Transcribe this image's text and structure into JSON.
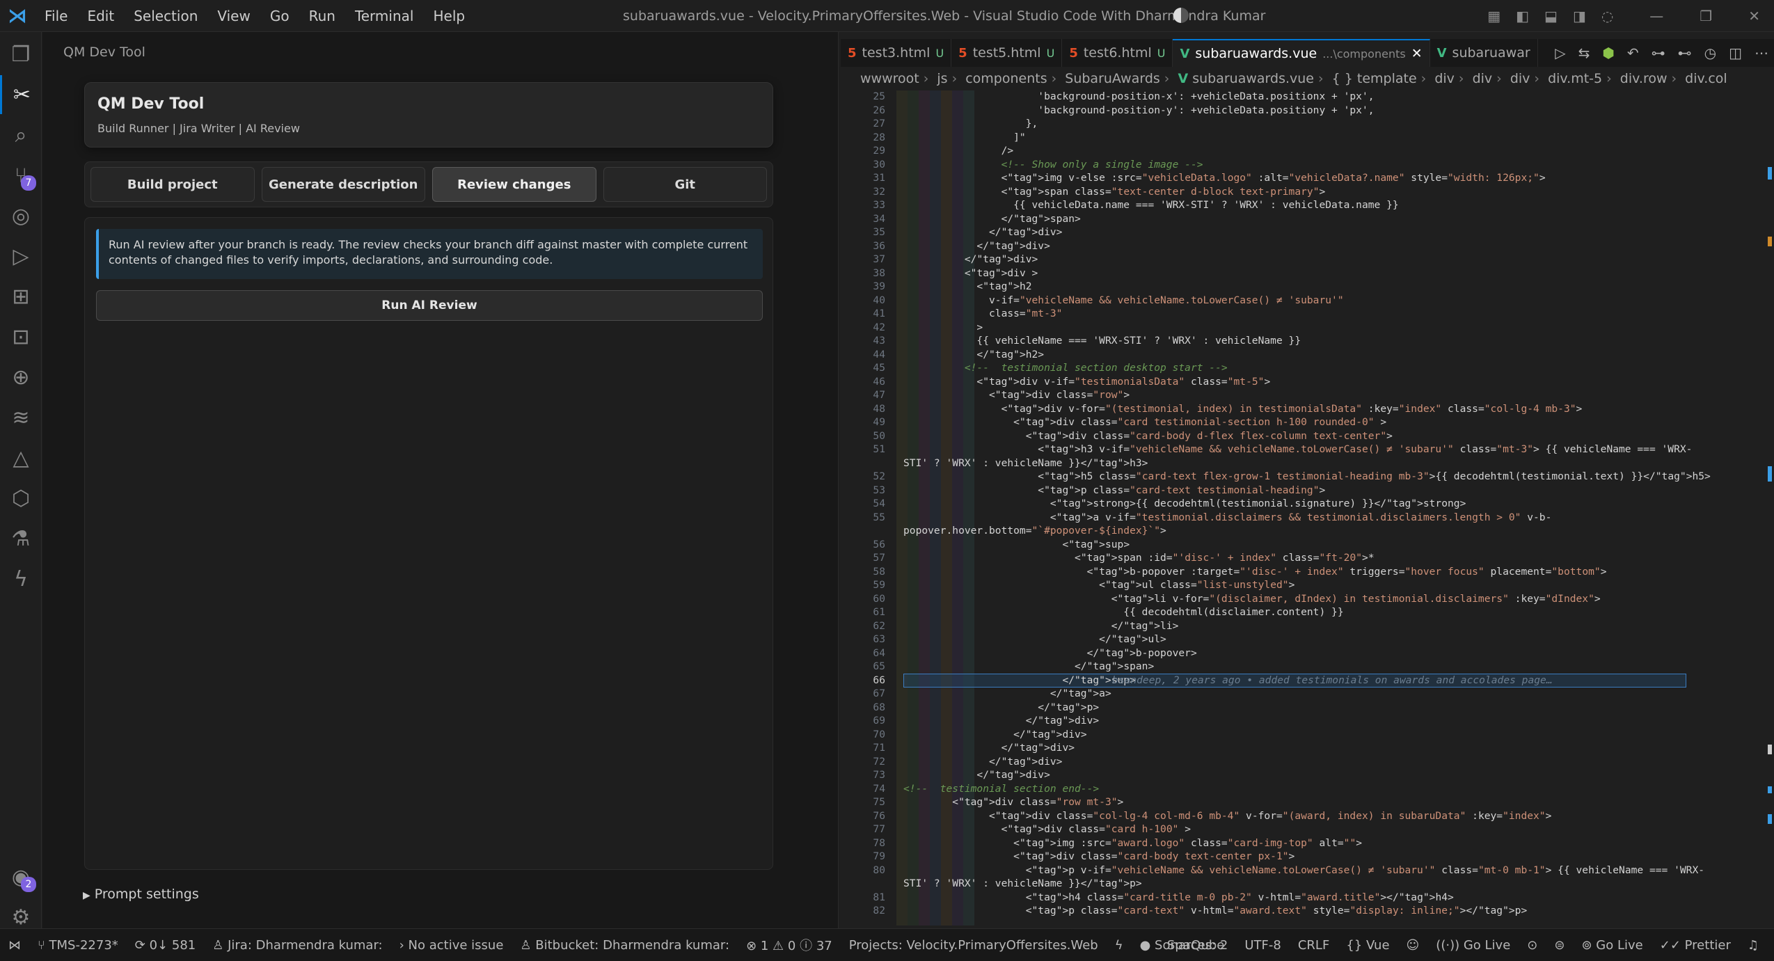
{
  "titlebar": {
    "menu": [
      "File",
      "Edit",
      "Selection",
      "View",
      "Go",
      "Run",
      "Terminal",
      "Help"
    ],
    "window_title": "subaruawards.vue - Velocity.PrimaryOffersites.Web - Visual Studio Code With Dharmendra Kumar"
  },
  "activity": {
    "scm_badge": "7",
    "accounts_badge": "2"
  },
  "sidepanel": {
    "title": "QM Dev Tool",
    "header_title": "QM Dev Tool",
    "header_subtitle": "Build Runner | Jira Writer | AI Review",
    "buttons": [
      "Build project",
      "Generate description",
      "Review changes",
      "Git"
    ],
    "active_button": "Review changes",
    "info_text": "Run AI review after your branch is ready. The review checks your branch diff against master with complete current contents of changed files to verify imports, declarations, and surrounding code.",
    "run_button": "Run AI Review",
    "prompt_settings": "Prompt settings"
  },
  "editor": {
    "tabs": [
      {
        "name": "test3.html",
        "status": "U",
        "type": "html"
      },
      {
        "name": "test5.html",
        "status": "U",
        "type": "html"
      },
      {
        "name": "test6.html",
        "status": "U",
        "type": "html"
      },
      {
        "name": "subaruawards.vue",
        "path": "...\\components",
        "type": "vue",
        "active": true
      },
      {
        "name": "subaruawar",
        "type": "vue"
      }
    ],
    "breadcrumb": [
      "wwwroot",
      "js",
      "components",
      "SubaruAwards",
      "subaruawards.vue",
      "{ } template",
      "div",
      "div",
      "div",
      "div.mt-5",
      "div.row",
      "div.col"
    ],
    "current_line": 66,
    "blame_text": "bsandeep, 2 years ago • added testimonials on awards and accolades page…",
    "lines": [
      {
        "n": "25",
        "t": "                      'background-position-x': +vehicleData.positionx + 'px',"
      },
      {
        "n": "26",
        "t": "                      'background-position-y': +vehicleData.positiony + 'px',"
      },
      {
        "n": "27",
        "t": "                    },"
      },
      {
        "n": "28",
        "t": "                  ]\""
      },
      {
        "n": "29",
        "t": "                />"
      },
      {
        "n": "30",
        "t": "                <!-- Show only a single image -->"
      },
      {
        "n": "31",
        "t": "                <img v-else :src=\"vehicleData.logo\" :alt=\"vehicleData?.name\" style=\"width: 126px;\">"
      },
      {
        "n": "32",
        "t": "                <span class=\"text-center d-block text-primary\">"
      },
      {
        "n": "33",
        "t": "                  {{ vehicleData.name === 'WRX-STI' ? 'WRX' : vehicleData.name }}"
      },
      {
        "n": "34",
        "t": "                </span>"
      },
      {
        "n": "35",
        "t": "              </div>"
      },
      {
        "n": "36",
        "t": "            </div>"
      },
      {
        "n": "37",
        "t": "          </div>"
      },
      {
        "n": "38",
        "t": "          <div >"
      },
      {
        "n": "39",
        "t": "            <h2"
      },
      {
        "n": "40",
        "t": "              v-if=\"vehicleName && vehicleName.toLowerCase() ≠ 'subaru'\""
      },
      {
        "n": "41",
        "t": "              class=\"mt-3\""
      },
      {
        "n": "42",
        "t": "            >"
      },
      {
        "n": "43",
        "t": "            {{ vehicleName === 'WRX-STI' ? 'WRX' : vehicleName }}"
      },
      {
        "n": "44",
        "t": "            </h2>"
      },
      {
        "n": "45",
        "t": "          <!--  testimonial section desktop start -->"
      },
      {
        "n": "46",
        "t": "            <div v-if=\"testimonialsData\" class=\"mt-5\">"
      },
      {
        "n": "47",
        "t": "              <div class=\"row\">"
      },
      {
        "n": "48",
        "t": "                <div v-for=\"(testimonial, index) in testimonialsData\" :key=\"index\" class=\"col-lg-4 mb-3\">"
      },
      {
        "n": "49",
        "t": "                  <div class=\"card testimonial-section h-100 rounded-0\" >"
      },
      {
        "n": "50",
        "t": "                    <div class=\"card-body d-flex flex-column text-center\">"
      },
      {
        "n": "51",
        "t": "                      <h3 v-if=\"vehicleName && vehicleName.toLowerCase() ≠ 'subaru'\" class=\"mt-3\"> {{ vehicleName === 'WRX-"
      },
      {
        "n": "",
        "t": "STI' ? 'WRX' : vehicleName }}</h3>"
      },
      {
        "n": "52",
        "t": "                      <h5 class=\"card-text flex-grow-1 testimonial-heading mb-3\">{{ decodehtml(testimonial.text) }}</h5>"
      },
      {
        "n": "53",
        "t": "                      <p class=\"card-text testimonial-heading\">"
      },
      {
        "n": "54",
        "t": "                        <strong>{{ decodehtml(testimonial.signature) }}</strong>"
      },
      {
        "n": "55",
        "t": "                        <a v-if=\"testimonial.disclaimers && testimonial.disclaimers.length > 0\" v-b-"
      },
      {
        "n": "",
        "t": "popover.hover.bottom=\"`#popover-${index}`\">"
      },
      {
        "n": "56",
        "t": "                          <sup>"
      },
      {
        "n": "57",
        "t": "                            <span :id=\"'disc-' + index\" class=\"ft-20\">*"
      },
      {
        "n": "58",
        "t": "                              <b-popover :target=\"'disc-' + index\" triggers=\"hover focus\" placement=\"bottom\">"
      },
      {
        "n": "59",
        "t": "                                <ul class=\"list-unstyled\">"
      },
      {
        "n": "60",
        "t": "                                  <li v-for=\"(disclaimer, dIndex) in testimonial.disclaimers\" :key=\"dIndex\">"
      },
      {
        "n": "61",
        "t": "                                    {{ decodehtml(disclaimer.content) }}"
      },
      {
        "n": "62",
        "t": "                                  </li>"
      },
      {
        "n": "63",
        "t": "                                </ul>"
      },
      {
        "n": "64",
        "t": "                              </b-popover>"
      },
      {
        "n": "65",
        "t": "                            </span>"
      },
      {
        "n": "66",
        "t": "                          </sup>"
      },
      {
        "n": "67",
        "t": "                        </a>"
      },
      {
        "n": "68",
        "t": "                      </p>"
      },
      {
        "n": "69",
        "t": "                    </div>"
      },
      {
        "n": "70",
        "t": "                  </div>"
      },
      {
        "n": "71",
        "t": "                </div>"
      },
      {
        "n": "72",
        "t": "              </div>"
      },
      {
        "n": "73",
        "t": "            </div>"
      },
      {
        "n": "74",
        "t": "<!--  testimonial section end-->"
      },
      {
        "n": "75",
        "t": "        <div class=\"row mt-3\">"
      },
      {
        "n": "76",
        "t": "              <div class=\"col-lg-4 col-md-6 mb-4\" v-for=\"(award, index) in subaruData\" :key=\"index\">"
      },
      {
        "n": "77",
        "t": "                <div class=\"card h-100\" >"
      },
      {
        "n": "78",
        "t": "                  <img :src=\"award.logo\" class=\"card-img-top\" alt=\"\">"
      },
      {
        "n": "79",
        "t": "                  <div class=\"card-body text-center px-1\">"
      },
      {
        "n": "80",
        "t": "                    <p v-if=\"vehicleName && vehicleName.toLowerCase() ≠ 'subaru'\" class=\"mt-0 mb-1\"> {{ vehicleName === 'WRX-"
      },
      {
        "n": "",
        "t": "STI' ? 'WRX' : vehicleName }}</p>"
      },
      {
        "n": "81",
        "t": "                    <h4 class=\"card-title m-0 pb-2\" v-html=\"award.title\"></h4>"
      },
      {
        "n": "82",
        "t": "                    <p class=\"card-text\" v-html=\"award.text\" style=\"display: inline;\"></p>"
      }
    ]
  },
  "statusbar": {
    "branch": "TMS-2273*",
    "sync": "0↓ 581",
    "jira": "Jira: Dharmendra kumar:",
    "issue": "No active issue",
    "bitbucket": "Bitbucket: Dharmendra kumar:",
    "errors": "1",
    "warnings": "0",
    "infos": "37",
    "project": "Projects: Velocity.PrimaryOffersites.Web",
    "sonar": "SonarQube",
    "spaces": "Spaces: 2",
    "encoding": "UTF-8",
    "eol": "CRLF",
    "language": "Vue",
    "golive1": "Go Live",
    "golive2": "Go Live",
    "prettier": "Prettier"
  }
}
